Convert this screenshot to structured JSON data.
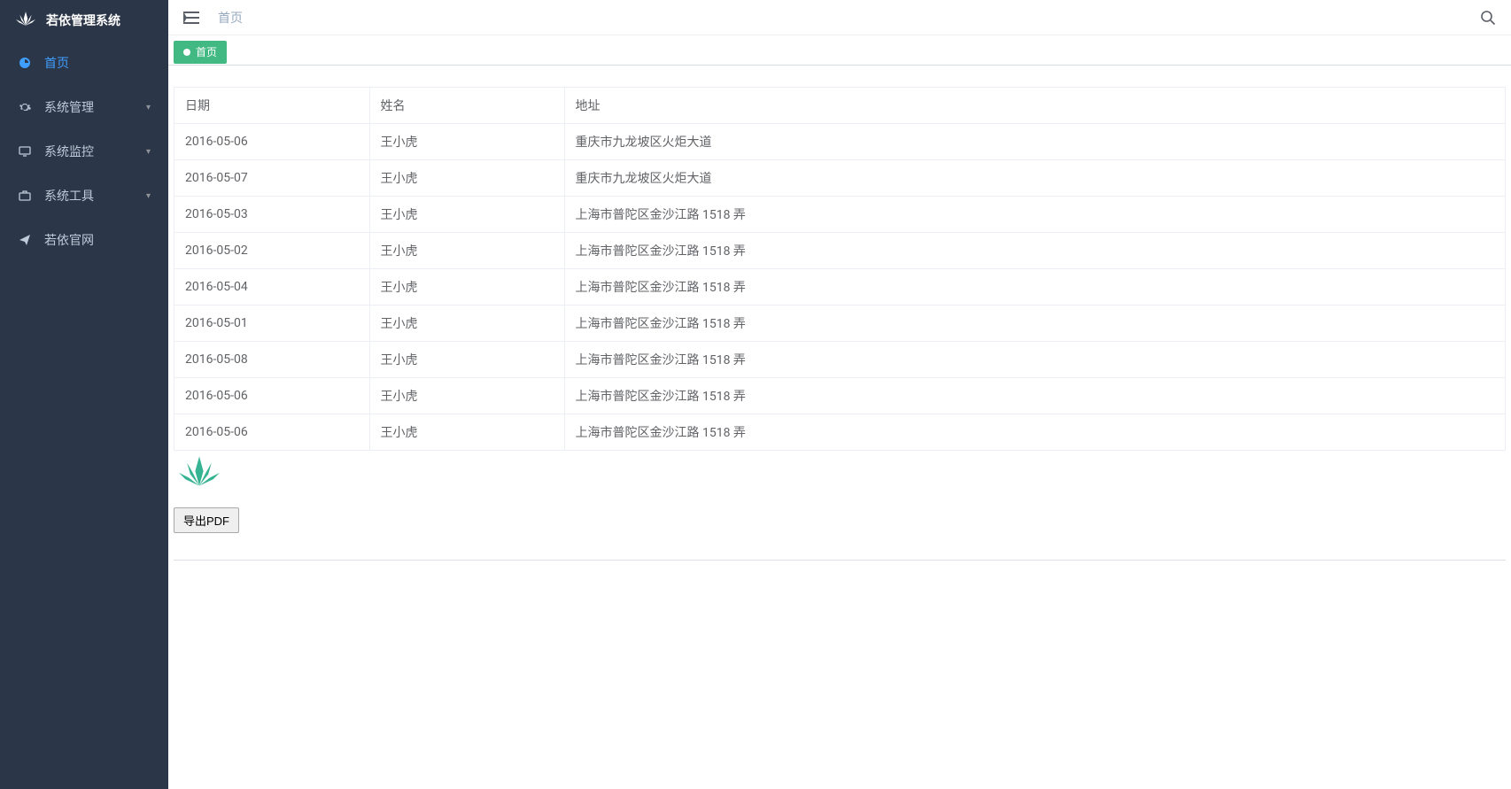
{
  "app": {
    "title": "若依管理系统"
  },
  "sidebar": {
    "items": [
      {
        "label": "首页",
        "icon": "dashboard-icon",
        "active": true,
        "hasChildren": false
      },
      {
        "label": "系统管理",
        "icon": "gear-icon",
        "active": false,
        "hasChildren": true
      },
      {
        "label": "系统监控",
        "icon": "monitor-icon",
        "active": false,
        "hasChildren": true
      },
      {
        "label": "系统工具",
        "icon": "toolbox-icon",
        "active": false,
        "hasChildren": true
      },
      {
        "label": "若依官网",
        "icon": "paper-plane-icon",
        "active": false,
        "hasChildren": false
      }
    ]
  },
  "header": {
    "breadcrumb": "首页"
  },
  "tabs": [
    {
      "label": "首页",
      "active": true
    }
  ],
  "table": {
    "columns": [
      {
        "key": "date",
        "label": "日期"
      },
      {
        "key": "name",
        "label": "姓名"
      },
      {
        "key": "address",
        "label": "地址"
      }
    ],
    "rows": [
      {
        "date": "2016-05-06",
        "name": "王小虎",
        "address": "重庆市九龙坡区火炬大道"
      },
      {
        "date": "2016-05-07",
        "name": "王小虎",
        "address": "重庆市九龙坡区火炬大道"
      },
      {
        "date": "2016-05-03",
        "name": "王小虎",
        "address": "上海市普陀区金沙江路 1518 弄"
      },
      {
        "date": "2016-05-02",
        "name": "王小虎",
        "address": "上海市普陀区金沙江路 1518 弄"
      },
      {
        "date": "2016-05-04",
        "name": "王小虎",
        "address": "上海市普陀区金沙江路 1518 弄"
      },
      {
        "date": "2016-05-01",
        "name": "王小虎",
        "address": "上海市普陀区金沙江路 1518 弄"
      },
      {
        "date": "2016-05-08",
        "name": "王小虎",
        "address": "上海市普陀区金沙江路 1518 弄"
      },
      {
        "date": "2016-05-06",
        "name": "王小虎",
        "address": "上海市普陀区金沙江路 1518 弄"
      },
      {
        "date": "2016-05-06",
        "name": "王小虎",
        "address": "上海市普陀区金沙江路 1518 弄"
      }
    ]
  },
  "buttons": {
    "export": "导出PDF"
  }
}
